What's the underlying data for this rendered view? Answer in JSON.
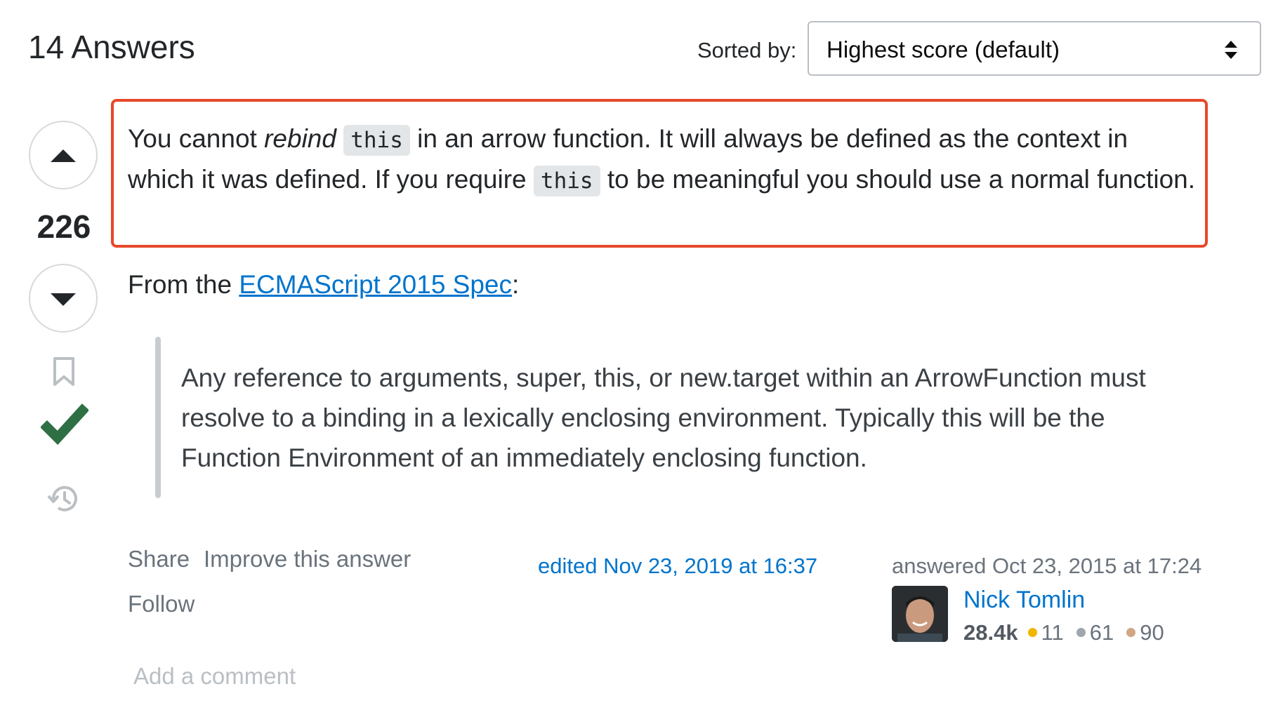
{
  "header": {
    "answers_count": "14 Answers",
    "sorted_label": "Sorted by:",
    "sort_value": "Highest score (default)"
  },
  "answer": {
    "score": "226",
    "para1": {
      "t1": "You cannot ",
      "em": "rebind",
      "t2": " ",
      "code1": "this",
      "t3": " in an arrow function. It will always be defined as the context in which it was defined. If you require ",
      "code2": "this",
      "t4": " to be meaningful you should use a normal function."
    },
    "para2": {
      "prefix": "From the ",
      "link": "ECMAScript 2015 Spec",
      "suffix": ":"
    },
    "quote": "Any reference to arguments, super, this, or new.target within an ArrowFunction must resolve to a binding in a lexically enclosing environment. Typically this will be the Function Environment of an immediately enclosing function.",
    "menu": {
      "share": "Share",
      "improve": "Improve this answer",
      "follow": "Follow"
    },
    "edited": "edited Nov 23, 2019 at 16:37",
    "answered": "answered Oct 23, 2015 at 17:24",
    "user": {
      "name": "Nick Tomlin",
      "reputation": "28.4k",
      "gold": "11",
      "silver": "61",
      "bronze": "90"
    },
    "add_comment": "Add a comment"
  },
  "colors": {
    "highlight_border": "#e6482b",
    "link": "#0074cc",
    "accepted": "#2f6f44",
    "gold": "#f1b600",
    "silver": "#9fa6ad",
    "bronze": "#d1a684"
  },
  "icons": [
    "sort-arrows-icon",
    "upvote-icon",
    "downvote-icon",
    "bookmark-icon",
    "accepted-check-icon",
    "history-icon"
  ]
}
